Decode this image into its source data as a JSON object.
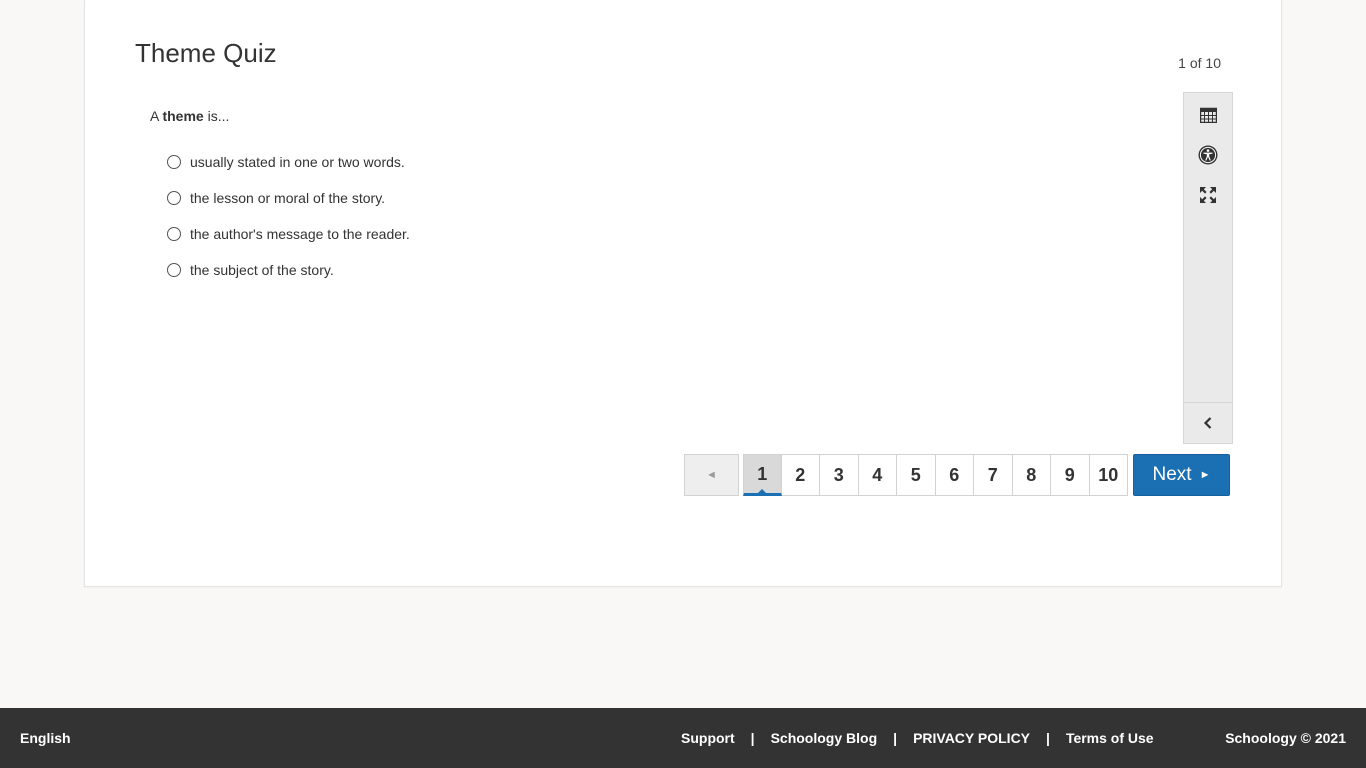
{
  "quiz": {
    "title": "Theme Quiz",
    "counter": "1 of 10",
    "question": {
      "prefix": "A ",
      "bold": "theme",
      "suffix": " is..."
    },
    "choices": [
      "usually stated in one or two words.",
      "the lesson or moral of the story.",
      "the author's message to the reader.",
      "the subject of the story."
    ]
  },
  "tools": {
    "icons": [
      "calendar-icon",
      "accessibility-icon",
      "expand-icon",
      "chevron-left-icon"
    ]
  },
  "pager": {
    "prev_symbol": "◄",
    "pages": [
      "1",
      "2",
      "3",
      "4",
      "5",
      "6",
      "7",
      "8",
      "9",
      "10"
    ],
    "current": "1",
    "next_label": "Next",
    "next_symbol": "►"
  },
  "footer": {
    "language": "English",
    "links": [
      "Support",
      "Schoology Blog",
      "PRIVACY POLICY",
      "Terms of Use"
    ],
    "separator": "|",
    "copyright": "Schoology © 2021"
  },
  "colors": {
    "accent": "#1b6fb3",
    "footer_bg": "#333333",
    "page_bg": "#f9f8f7"
  }
}
